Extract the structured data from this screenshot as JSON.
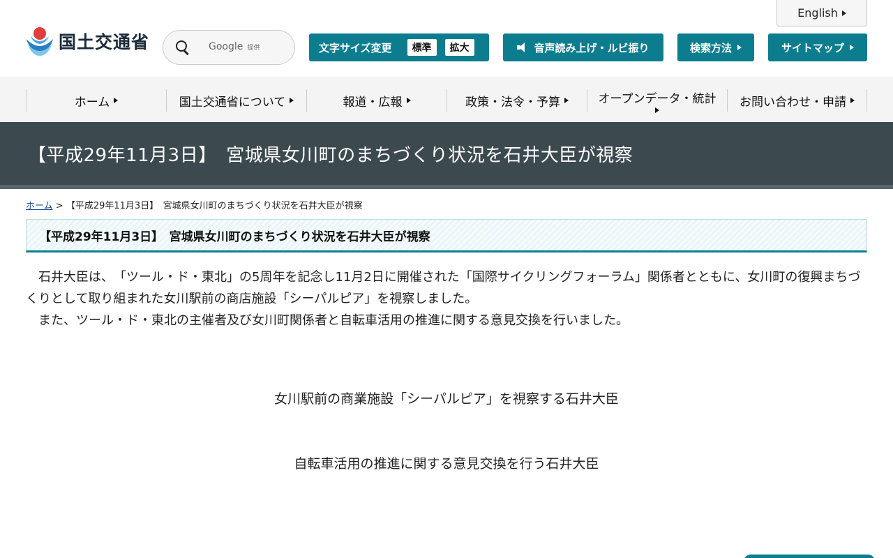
{
  "header": {
    "logo_text": "国土交通省",
    "search": {
      "placeholder": "",
      "google_label": "Google",
      "google_suffix": "提供"
    },
    "english_label": "English",
    "font_size": {
      "label": "文字サイズ変更",
      "standard": "標準",
      "large": "拡大"
    },
    "voice_label": "音声読み上げ・ルビ振り",
    "search_method_label": "検索方法",
    "sitemap_label": "サイトマップ"
  },
  "nav": {
    "items": [
      "ホーム",
      "国土交通省について",
      "報道・広報",
      "政策・法令・予算",
      "オープンデータ・統計",
      "お問い合わせ・申請"
    ]
  },
  "page": {
    "title": "【平成29年11月3日】　宮城県女川町のまちづくり状況を石井大臣が視察",
    "breadcrumb_home": "ホーム",
    "breadcrumb_sep": ">",
    "breadcrumb_current": "【平成29年11月3日】　宮城県女川町のまちづくり状況を石井大臣が視察",
    "section_heading": "【平成29年11月3日】　宮城県女川町のまちづくり状況を石井大臣が視察",
    "paragraph1": "　石井大臣は、　「ツール・ド・東北」の5周年を記念し11月2日に開催された「国際サイクリングフォーラム」関係者とともに、女川町の復興まちづくりとして取り組まれた女川駅前の商店施設「シーパルピア」を視察しました。",
    "paragraph2": "　また、ツール・ド・東北の主催者及び女川町関係者と自転車活用の推進に関する意見交換を行いました。",
    "caption1": "女川駅前の商業施設「シーパルピア」を視察する石井大臣",
    "caption2": "自転車活用の推進に関する意見交換を行う石井大臣"
  },
  "colors": {
    "accent": "#0c7d8f",
    "title_band": "#3c4a50"
  }
}
